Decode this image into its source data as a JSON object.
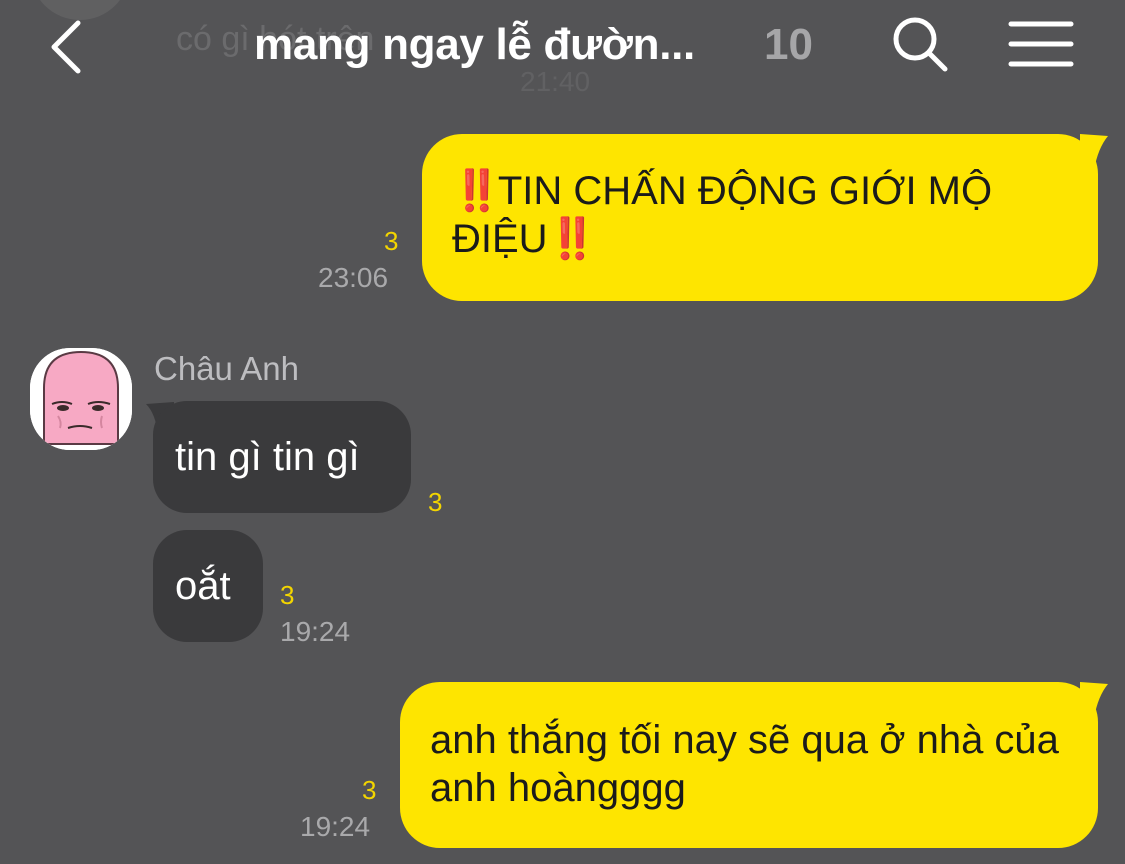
{
  "header": {
    "title": "mang ngay lễ đườn...",
    "member_count": "10",
    "background_preview_text": "có gì hót trên",
    "background_preview_time": "21:40"
  },
  "icons": {
    "back": "chevron-left-icon",
    "search": "search-icon",
    "menu": "hamburger-menu-icon"
  },
  "colors": {
    "background": "#545456",
    "my_bubble": "#fee500",
    "other_bubble": "#3a3a3c",
    "unread_count": "#f3d500",
    "alert_mark": "#e0141a"
  },
  "messages": [
    {
      "sender": "me",
      "text_prefix": "‼️",
      "text": "TIN CHẤN ĐỘNG GIỚI MỘ ĐIỆU",
      "text_suffix": "‼️",
      "unread": "3",
      "time": "23:06"
    },
    {
      "sender": "Châu Anh",
      "text": "tin gì tin gì",
      "unread": "3"
    },
    {
      "sender": "Châu Anh",
      "text": "oắt",
      "unread": "3",
      "time": "19:24"
    },
    {
      "sender": "me",
      "text": "anh thắng tối nay sẽ qua ở nhà của anh hoàngggg",
      "unread": "3",
      "time": "19:24"
    }
  ],
  "other_user": {
    "name": "Châu Anh"
  }
}
